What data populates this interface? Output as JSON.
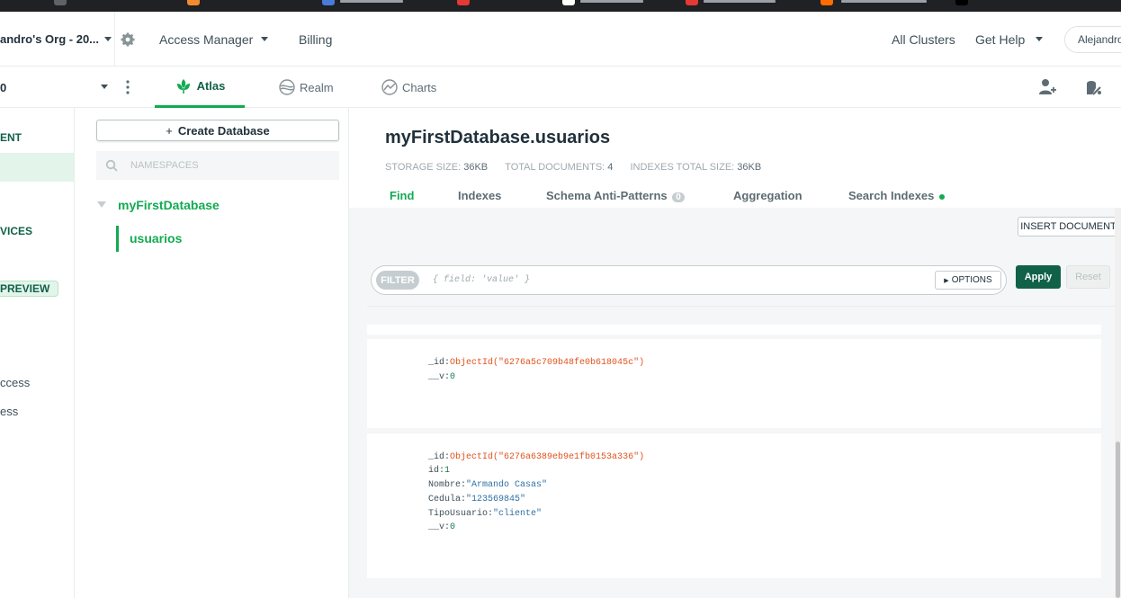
{
  "topbar": {
    "org_name": "andro's Org - 20...",
    "access_manager": "Access Manager",
    "billing": "Billing",
    "all_clusters": "All Clusters",
    "get_help": "Get Help",
    "user": "Alejandro"
  },
  "navbar": {
    "project": "0",
    "tabs": [
      {
        "label": "Atlas",
        "icon": "atlas-leaf-icon",
        "active": true
      },
      {
        "label": "Realm",
        "icon": "realm-icon",
        "active": false
      },
      {
        "label": "Charts",
        "icon": "charts-icon",
        "active": false
      }
    ]
  },
  "sidebar": {
    "items": [
      "ENT",
      "VICES",
      "PREVIEW",
      "ccess",
      "ess"
    ]
  },
  "dbpanel": {
    "create_button": "Create Database",
    "namespace_placeholder": "NAMESPACES",
    "database": "myFirstDatabase",
    "collection": "usuarios"
  },
  "main": {
    "title": "myFirstDatabase.usuarios",
    "stats": {
      "storage_label": "STORAGE SIZE:",
      "storage_value": "36KB",
      "docs_label": "TOTAL DOCUMENTS:",
      "docs_value": "4",
      "indexes_label": "INDEXES TOTAL SIZE:",
      "indexes_value": "36KB"
    },
    "tabs": [
      "Find",
      "Indexes",
      "Schema Anti-Patterns",
      "Aggregation",
      "Search Indexes"
    ],
    "schema_badge": "0",
    "insert_button": "INSERT DOCUMENT",
    "filter_label": "FILTER",
    "filter_placeholder": "{ field: 'value' }",
    "options_button": "OPTIONS",
    "apply_button": "Apply",
    "reset_button": "Reset"
  },
  "documents": [
    {
      "fields": [
        {
          "key": "_id",
          "value": "ObjectId(\"6276a5c709b48fe0b618045c\")",
          "type": "oid"
        },
        {
          "key": "__v",
          "value": "0",
          "type": "num"
        }
      ]
    },
    {
      "fields": [
        {
          "key": "_id",
          "value": "ObjectId(\"6276a6389eb9e1fb0153a336\")",
          "type": "oid"
        },
        {
          "key": "id",
          "value": "1",
          "type": "num"
        },
        {
          "key": "Nombre",
          "value": "\"Armando Casas\"",
          "type": "str"
        },
        {
          "key": "Cedula",
          "value": "\"123569845\"",
          "type": "str"
        },
        {
          "key": "TipoUsuario",
          "value": "\"cliente\"",
          "type": "str"
        },
        {
          "key": "__v",
          "value": "0",
          "type": "num"
        }
      ]
    }
  ],
  "colors": {
    "accent": "#13aa52",
    "apply_bg": "#116149",
    "oid": "#e0531f",
    "string": "#2f6fa4",
    "number": "#137b4d"
  }
}
